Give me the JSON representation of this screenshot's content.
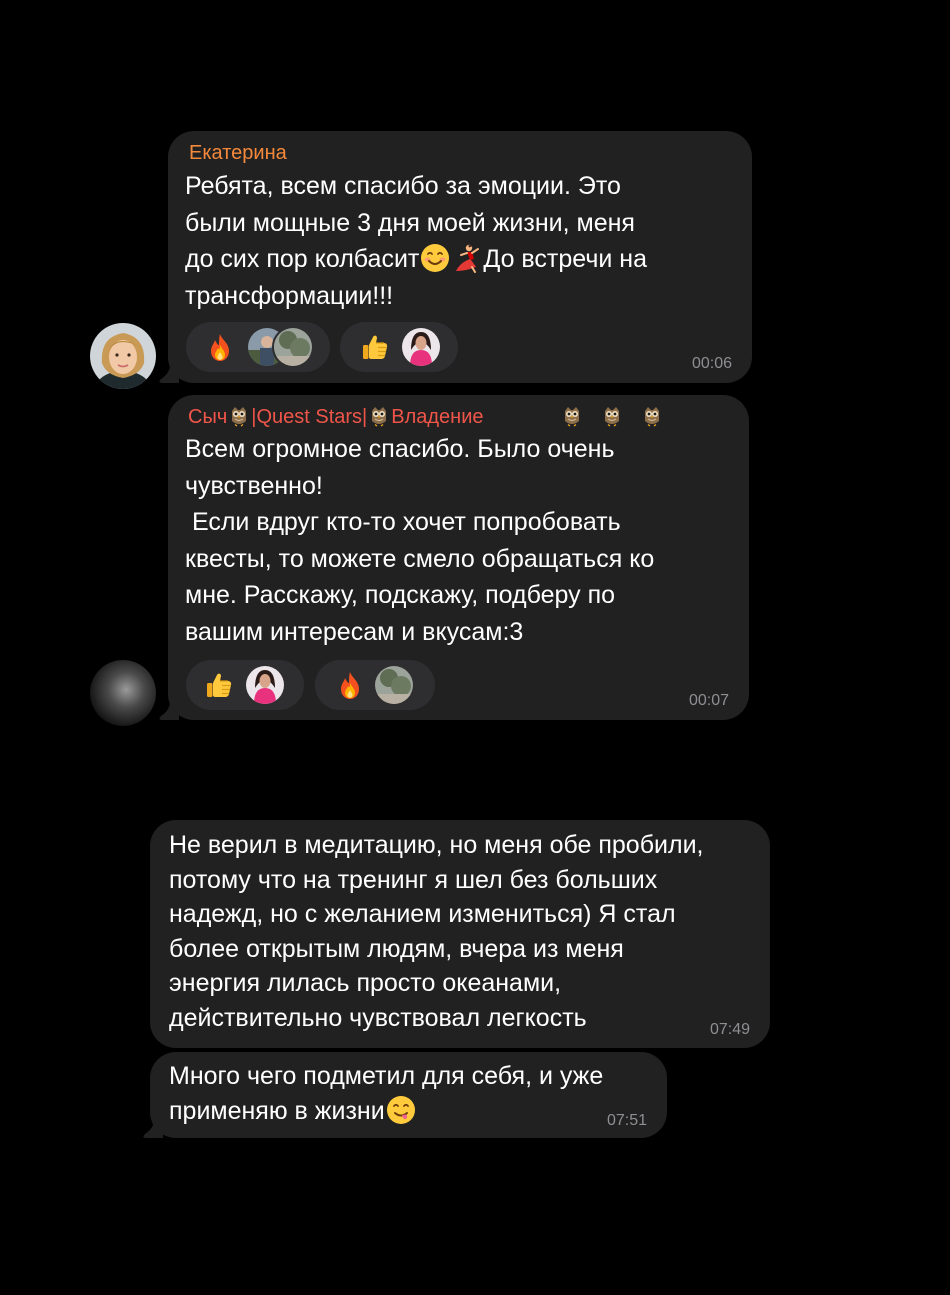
{
  "messages": [
    {
      "sender": "Екатерина",
      "sender_color": "#f5893b",
      "lines": [
        "Ребята, всем спасибо за эмоции. Это",
        "были мощные 3 дня моей жизни, меня",
        "до сих пор колбасит",
        "До встречи на",
        "трансформации!!!"
      ],
      "inline_emoji": [
        "smiling-face-emoji",
        "dancer-emoji"
      ],
      "reactions": [
        {
          "emoji": "fire-emoji",
          "users": 2
        },
        {
          "emoji": "thumbs-up-emoji",
          "users": 1
        }
      ],
      "time": "00:06"
    },
    {
      "sender_parts": [
        "Сыч",
        "|Quest Stars|",
        "Владение"
      ],
      "sender_icon": "owl-emoji",
      "sender_color": "#f0554a",
      "lines": [
        "Всем огромное спасибо. Было очень",
        "чувственно!",
        " Если вдруг кто-то хочет попробовать",
        "квесты, то можете смело обращаться ко",
        "мне. Расскажу, подскажу, подберу по",
        "вашим интересам и вкусам:3"
      ],
      "reactions": [
        {
          "emoji": "thumbs-up-emoji",
          "users": 1
        },
        {
          "emoji": "fire-emoji",
          "users": 1
        }
      ],
      "time": "00:07"
    },
    {
      "lines": [
        "Не верил в медитацию, но меня обе пробили,",
        "потому что на тренинг я шел без больших",
        "надежд, но с желанием измениться) Я стал",
        "более открытым людям, вчера из меня",
        "энергия лилась просто океанами,",
        "действительно чувствовал легкость"
      ],
      "time": "07:49"
    },
    {
      "lines": [
        "Много чего подметил для себя, и уже",
        "применяю в жизни"
      ],
      "inline_emoji": [
        "yum-face-emoji"
      ],
      "time": "07:51"
    }
  ],
  "colors": {
    "background": "#000000",
    "bubble": "#212121",
    "reaction_pill": "#2e2e30",
    "timestamp": "#8e8e93"
  }
}
